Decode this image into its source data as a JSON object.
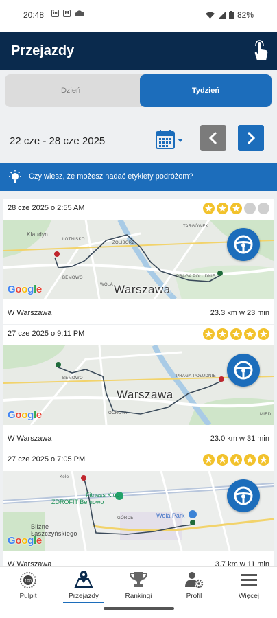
{
  "status": {
    "time": "20:48",
    "icons": [
      "linkedin-icon",
      "mail-icon",
      "cloud-icon"
    ],
    "battery": "82%"
  },
  "header": {
    "title": "Przejazdy"
  },
  "period_tabs": [
    {
      "label": "Dzień",
      "selected": false
    },
    {
      "label": "Tydzień",
      "selected": true
    }
  ],
  "date_range": "22 cze - 28 cze 2025",
  "tip": "Czy wiesz, że możesz nadać etykiety podróżom?",
  "colors": {
    "primary": "#1c6dbb",
    "header": "#0a2a4d",
    "star": "#f2c22c"
  },
  "trips": [
    {
      "date": "28 cze 2025 o 2:55 AM",
      "rating": 3,
      "area": "W Warszawa",
      "distance": "23.3 km w 23 min",
      "map": {
        "city": "Warszawa",
        "labels": [
          "Klaudyn",
          "LOTNISKO",
          "BEMOWO",
          "WOLA",
          "ŻOLIBORZ",
          "TARGÓWEK",
          "PRAGA POŁUDNIE"
        ],
        "attribution": "Google"
      }
    },
    {
      "date": "27 cze 2025 o 9:11 PM",
      "rating": 5,
      "area": "W Warszawa",
      "distance": "23.0 km w 31 min",
      "map": {
        "city": "Warszawa",
        "labels": [
          "BEMOWO",
          "OCHOTA",
          "PRAGA-POŁUDNIE",
          "MIĘD"
        ],
        "attribution": "Google"
      }
    },
    {
      "date": "27 cze 2025 o 7:05 PM",
      "rating": 5,
      "area": "W Warszawa",
      "distance": "3.7 km w 11 min",
      "map": {
        "city": "",
        "labels": [
          "Fitness Klub",
          "ZDROFIT Bemowo",
          "Wola Park",
          "GÓRCE",
          "Blizne Łaszczyńskiego",
          "Koło"
        ],
        "attribution": "Google"
      }
    }
  ],
  "nav": [
    {
      "label": "Pulpit",
      "icon": "gauge-icon",
      "active": false
    },
    {
      "label": "Przejazdy",
      "icon": "map-icon",
      "active": true
    },
    {
      "label": "Rankingi",
      "icon": "trophy-icon",
      "active": false
    },
    {
      "label": "Profil",
      "icon": "profile-settings-icon",
      "active": false
    },
    {
      "label": "Więcej",
      "icon": "menu-icon",
      "active": false
    }
  ]
}
